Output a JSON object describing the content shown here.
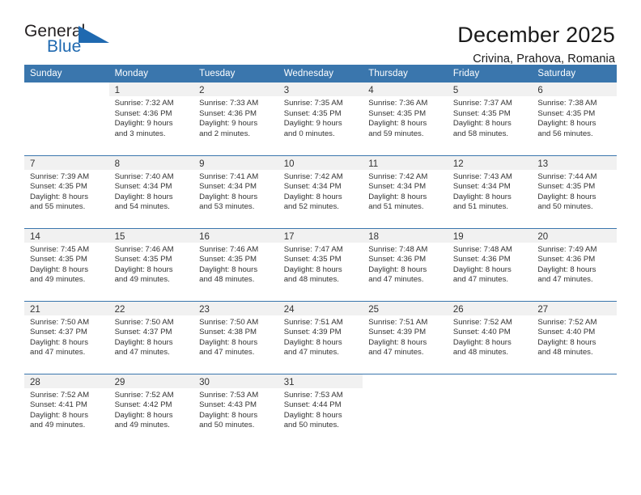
{
  "brand": {
    "word_one": "General",
    "word_two": "Blue",
    "triangle_color": "#1f69b0",
    "logo_icon": "triangle-logo-icon"
  },
  "header": {
    "title": "December 2025",
    "subtitle": "Crivina, Prahova, Romania"
  },
  "theme": {
    "header_blue": "#3a76ad",
    "daynum_band": "#f1f1f1",
    "text": "#333333"
  },
  "weekday_headers": [
    "Sunday",
    "Monday",
    "Tuesday",
    "Wednesday",
    "Thursday",
    "Friday",
    "Saturday"
  ],
  "weeks": [
    [
      {
        "day": "",
        "lines": []
      },
      {
        "day": "1",
        "lines": [
          "Sunrise: 7:32 AM",
          "Sunset: 4:36 PM",
          "Daylight: 9 hours",
          "and 3 minutes."
        ]
      },
      {
        "day": "2",
        "lines": [
          "Sunrise: 7:33 AM",
          "Sunset: 4:36 PM",
          "Daylight: 9 hours",
          "and 2 minutes."
        ]
      },
      {
        "day": "3",
        "lines": [
          "Sunrise: 7:35 AM",
          "Sunset: 4:35 PM",
          "Daylight: 9 hours",
          "and 0 minutes."
        ]
      },
      {
        "day": "4",
        "lines": [
          "Sunrise: 7:36 AM",
          "Sunset: 4:35 PM",
          "Daylight: 8 hours",
          "and 59 minutes."
        ]
      },
      {
        "day": "5",
        "lines": [
          "Sunrise: 7:37 AM",
          "Sunset: 4:35 PM",
          "Daylight: 8 hours",
          "and 58 minutes."
        ]
      },
      {
        "day": "6",
        "lines": [
          "Sunrise: 7:38 AM",
          "Sunset: 4:35 PM",
          "Daylight: 8 hours",
          "and 56 minutes."
        ]
      }
    ],
    [
      {
        "day": "7",
        "lines": [
          "Sunrise: 7:39 AM",
          "Sunset: 4:35 PM",
          "Daylight: 8 hours",
          "and 55 minutes."
        ]
      },
      {
        "day": "8",
        "lines": [
          "Sunrise: 7:40 AM",
          "Sunset: 4:34 PM",
          "Daylight: 8 hours",
          "and 54 minutes."
        ]
      },
      {
        "day": "9",
        "lines": [
          "Sunrise: 7:41 AM",
          "Sunset: 4:34 PM",
          "Daylight: 8 hours",
          "and 53 minutes."
        ]
      },
      {
        "day": "10",
        "lines": [
          "Sunrise: 7:42 AM",
          "Sunset: 4:34 PM",
          "Daylight: 8 hours",
          "and 52 minutes."
        ]
      },
      {
        "day": "11",
        "lines": [
          "Sunrise: 7:42 AM",
          "Sunset: 4:34 PM",
          "Daylight: 8 hours",
          "and 51 minutes."
        ]
      },
      {
        "day": "12",
        "lines": [
          "Sunrise: 7:43 AM",
          "Sunset: 4:34 PM",
          "Daylight: 8 hours",
          "and 51 minutes."
        ]
      },
      {
        "day": "13",
        "lines": [
          "Sunrise: 7:44 AM",
          "Sunset: 4:35 PM",
          "Daylight: 8 hours",
          "and 50 minutes."
        ]
      }
    ],
    [
      {
        "day": "14",
        "lines": [
          "Sunrise: 7:45 AM",
          "Sunset: 4:35 PM",
          "Daylight: 8 hours",
          "and 49 minutes."
        ]
      },
      {
        "day": "15",
        "lines": [
          "Sunrise: 7:46 AM",
          "Sunset: 4:35 PM",
          "Daylight: 8 hours",
          "and 49 minutes."
        ]
      },
      {
        "day": "16",
        "lines": [
          "Sunrise: 7:46 AM",
          "Sunset: 4:35 PM",
          "Daylight: 8 hours",
          "and 48 minutes."
        ]
      },
      {
        "day": "17",
        "lines": [
          "Sunrise: 7:47 AM",
          "Sunset: 4:35 PM",
          "Daylight: 8 hours",
          "and 48 minutes."
        ]
      },
      {
        "day": "18",
        "lines": [
          "Sunrise: 7:48 AM",
          "Sunset: 4:36 PM",
          "Daylight: 8 hours",
          "and 47 minutes."
        ]
      },
      {
        "day": "19",
        "lines": [
          "Sunrise: 7:48 AM",
          "Sunset: 4:36 PM",
          "Daylight: 8 hours",
          "and 47 minutes."
        ]
      },
      {
        "day": "20",
        "lines": [
          "Sunrise: 7:49 AM",
          "Sunset: 4:36 PM",
          "Daylight: 8 hours",
          "and 47 minutes."
        ]
      }
    ],
    [
      {
        "day": "21",
        "lines": [
          "Sunrise: 7:50 AM",
          "Sunset: 4:37 PM",
          "Daylight: 8 hours",
          "and 47 minutes."
        ]
      },
      {
        "day": "22",
        "lines": [
          "Sunrise: 7:50 AM",
          "Sunset: 4:37 PM",
          "Daylight: 8 hours",
          "and 47 minutes."
        ]
      },
      {
        "day": "23",
        "lines": [
          "Sunrise: 7:50 AM",
          "Sunset: 4:38 PM",
          "Daylight: 8 hours",
          "and 47 minutes."
        ]
      },
      {
        "day": "24",
        "lines": [
          "Sunrise: 7:51 AM",
          "Sunset: 4:39 PM",
          "Daylight: 8 hours",
          "and 47 minutes."
        ]
      },
      {
        "day": "25",
        "lines": [
          "Sunrise: 7:51 AM",
          "Sunset: 4:39 PM",
          "Daylight: 8 hours",
          "and 47 minutes."
        ]
      },
      {
        "day": "26",
        "lines": [
          "Sunrise: 7:52 AM",
          "Sunset: 4:40 PM",
          "Daylight: 8 hours",
          "and 48 minutes."
        ]
      },
      {
        "day": "27",
        "lines": [
          "Sunrise: 7:52 AM",
          "Sunset: 4:40 PM",
          "Daylight: 8 hours",
          "and 48 minutes."
        ]
      }
    ],
    [
      {
        "day": "28",
        "lines": [
          "Sunrise: 7:52 AM",
          "Sunset: 4:41 PM",
          "Daylight: 8 hours",
          "and 49 minutes."
        ]
      },
      {
        "day": "29",
        "lines": [
          "Sunrise: 7:52 AM",
          "Sunset: 4:42 PM",
          "Daylight: 8 hours",
          "and 49 minutes."
        ]
      },
      {
        "day": "30",
        "lines": [
          "Sunrise: 7:53 AM",
          "Sunset: 4:43 PM",
          "Daylight: 8 hours",
          "and 50 minutes."
        ]
      },
      {
        "day": "31",
        "lines": [
          "Sunrise: 7:53 AM",
          "Sunset: 4:44 PM",
          "Daylight: 8 hours",
          "and 50 minutes."
        ]
      },
      {
        "day": "",
        "lines": []
      },
      {
        "day": "",
        "lines": []
      },
      {
        "day": "",
        "lines": []
      }
    ]
  ]
}
